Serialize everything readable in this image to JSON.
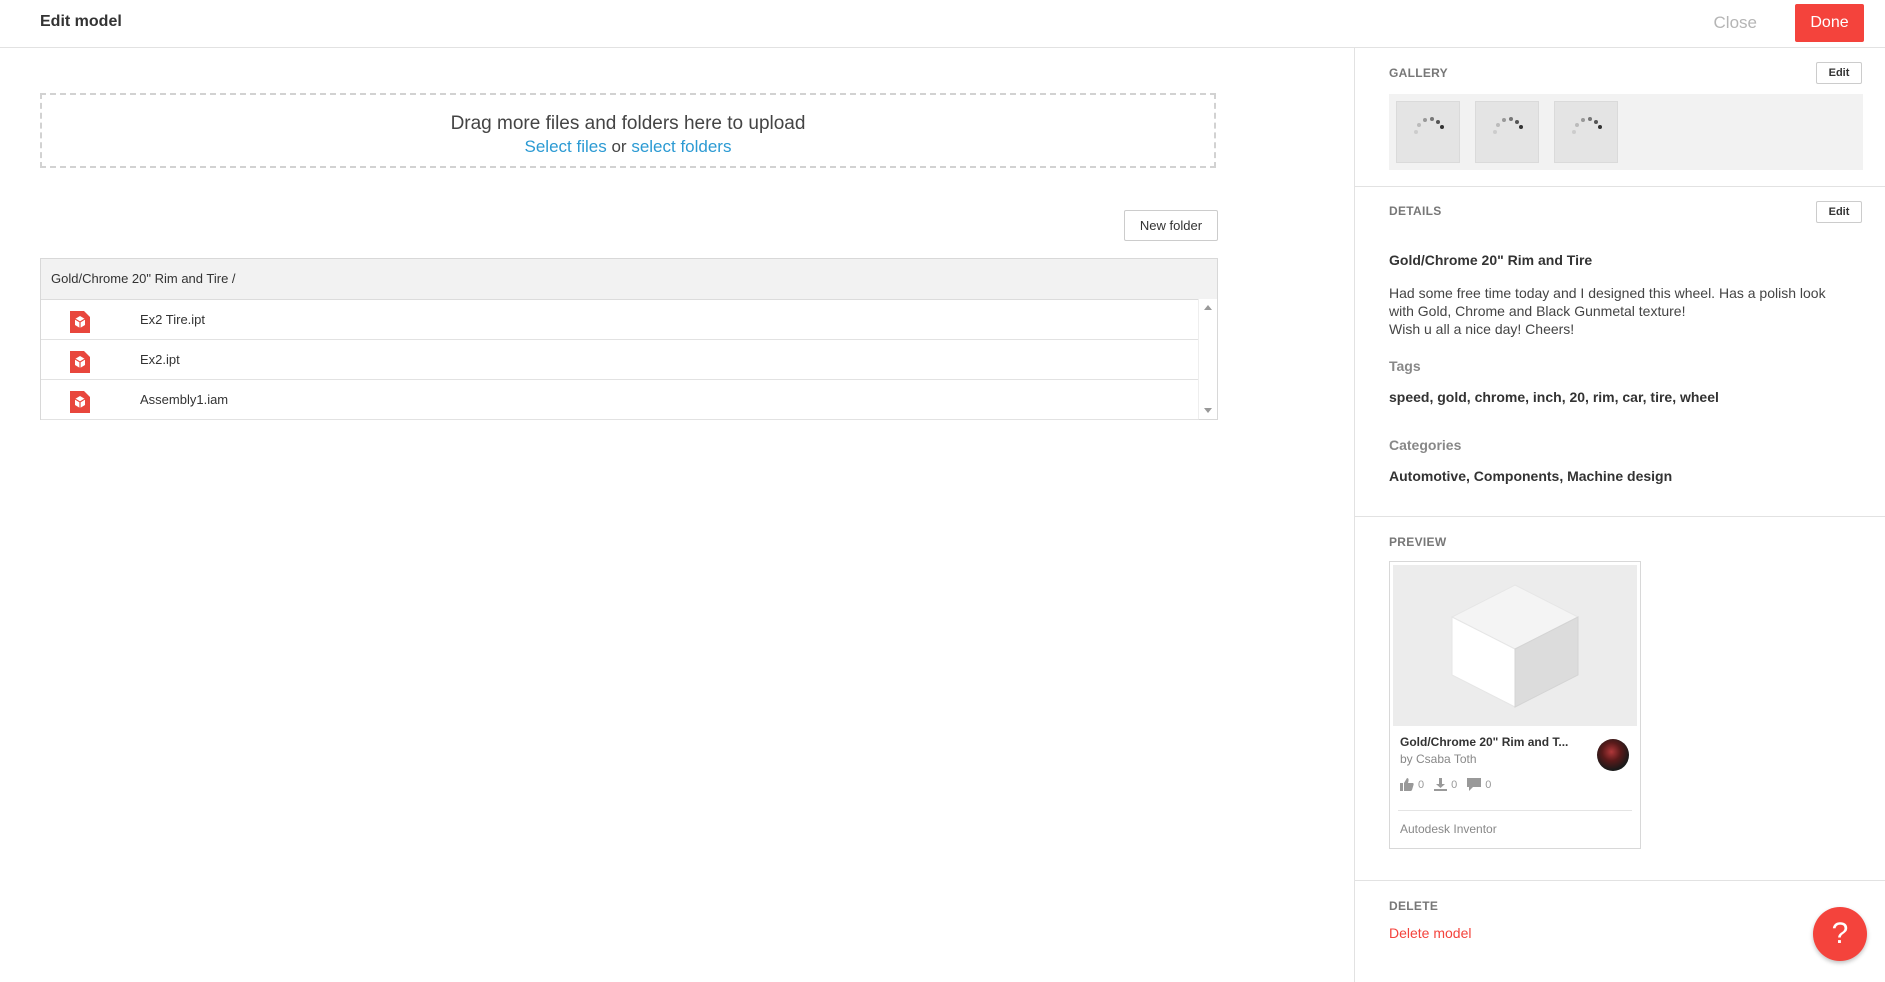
{
  "header": {
    "title": "Edit model",
    "close_label": "Close",
    "done_label": "Done"
  },
  "upload": {
    "prompt": "Drag more files and folders here to upload",
    "select_files": "Select files",
    "or": "or",
    "select_folders": "select folders"
  },
  "files": {
    "new_folder_label": "New folder",
    "breadcrumb": "Gold/Chrome 20\" Rim and Tire /",
    "items": [
      {
        "name": "Ex2 Tire.ipt",
        "icon": "inventor-file-icon"
      },
      {
        "name": "Ex2.ipt",
        "icon": "inventor-file-icon"
      },
      {
        "name": "Assembly1.iam",
        "icon": "inventor-file-icon"
      }
    ]
  },
  "sidebar": {
    "gallery": {
      "label": "GALLERY",
      "edit_label": "Edit",
      "thumb_count": 3
    },
    "details": {
      "label": "DETAILS",
      "edit_label": "Edit",
      "title": "Gold/Chrome 20\" Rim and Tire",
      "description_lines": [
        "Had some free time today and I designed this wheel. Has a polish look",
        "with Gold, Chrome and Black Gunmetal texture!",
        "Wish u all a nice day! Cheers!"
      ],
      "tags_label": "Tags",
      "tags": "speed, gold, chrome, inch, 20, rim, car, tire, wheel",
      "categories_label": "Categories",
      "categories": "Automotive, Components, Machine design"
    },
    "preview": {
      "label": "PREVIEW",
      "card_title": "Gold/Chrome 20\" Rim and T...",
      "author": "by Csaba Toth",
      "likes": "0",
      "downloads": "0",
      "comments": "0",
      "app": "Autodesk Inventor"
    },
    "delete": {
      "label": "DELETE",
      "link": "Delete model"
    }
  },
  "help": {
    "icon": "?"
  },
  "colors": {
    "accent": "#f4433c",
    "link": "#2b9ad3"
  }
}
